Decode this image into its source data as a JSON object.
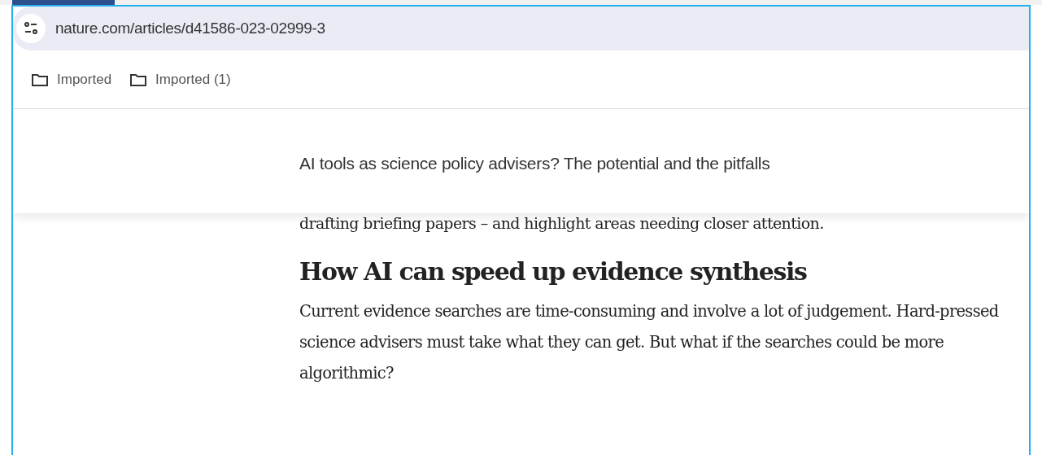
{
  "address_bar": {
    "url": "nature.com/articles/d41586-023-02999-3"
  },
  "bookmarks": [
    {
      "label": "Imported"
    },
    {
      "label": "Imported (1)"
    }
  ],
  "sticky_header": {
    "title": "AI tools as science policy advisers? The potential and the pitfalls"
  },
  "article": {
    "partial_line": "drafting briefing papers – and highlight areas needing closer attention.",
    "heading": "How AI can speed up evidence synthesis",
    "paragraph": "Current evidence searches are time-consuming and involve a lot of judgement. Hard-pressed science advisers must take what they can get. But what if the searches could be more algorithmic?"
  }
}
